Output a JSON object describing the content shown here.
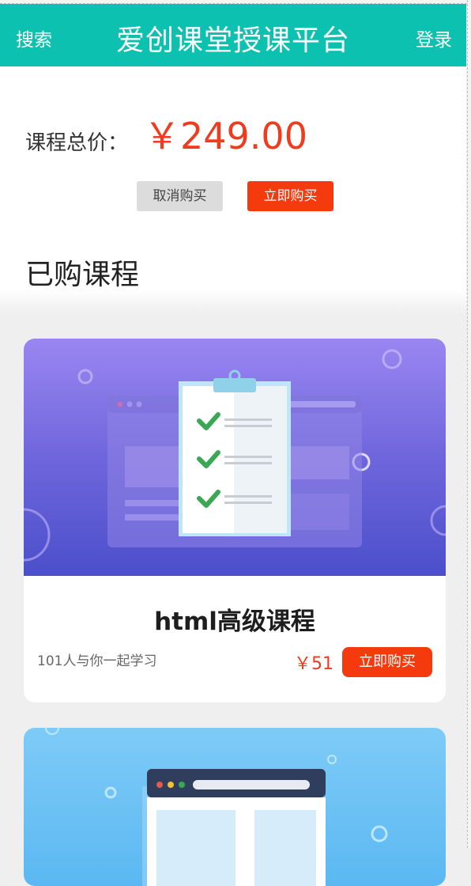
{
  "header": {
    "search_label": "搜索",
    "title": "爱创课堂授课平台",
    "login_label": "登录"
  },
  "summary": {
    "total_label": "课程总价：",
    "total_value": "￥249.00",
    "cancel_label": "取消购买",
    "buy_label": "立即购买"
  },
  "purchased": {
    "section_title": "已购课程",
    "courses": [
      {
        "name": "html高级课程",
        "learners": "101人与你一起学习",
        "price": "￥51",
        "buy_label": "立即购买"
      }
    ]
  },
  "colors": {
    "header_bg": "#0cc1b0",
    "accent_red": "#f53a0d",
    "price_red": "#f03c1e",
    "banner_purple": "#6f66dc",
    "banner_blue": "#5bb8f2"
  },
  "icons": {
    "banner_1": "clipboard-checklist-icon",
    "banner_2": "browser-window-icon"
  }
}
